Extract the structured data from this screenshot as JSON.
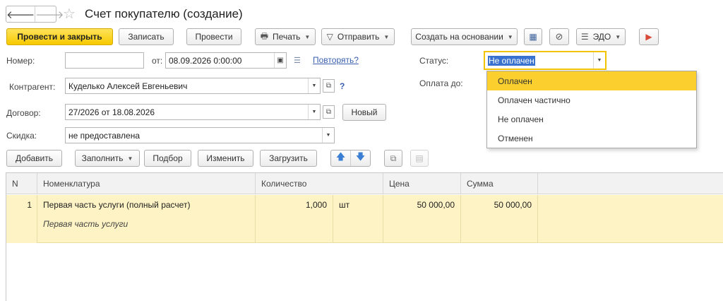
{
  "header": {
    "title": "Счет покупателю (создание)",
    "back_glyph": "🡐",
    "forward_glyph": "🡒"
  },
  "toolbar": {
    "post_close": "Провести и закрыть",
    "save": "Записать",
    "post": "Провести",
    "print": "Печать",
    "send": "Отправить",
    "create_based": "Создать на основании",
    "edo": "ЭДО"
  },
  "form": {
    "number_label": "Номер:",
    "number_value": "",
    "date_label": "от:",
    "date_value": "08.09.2026  0:00:00",
    "repeat_link": "Повторять?",
    "contractor_label": "Контрагент:",
    "contractor_value": "Куделько Алексей Евгеньевич",
    "help": "?",
    "contract_label": "Договор:",
    "contract_value": "27/2026 от 18.08.2026",
    "new_button": "Новый",
    "discount_label": "Скидка:",
    "discount_value": "не предоставлена",
    "status_label": "Статус:",
    "status_value": "Не оплачен",
    "pay_until_label": "Оплата до:"
  },
  "status_dropdown": {
    "options": [
      "Оплачен",
      "Оплачен частично",
      "Не оплачен",
      "Отменен"
    ],
    "highlighted": "Оплачен"
  },
  "table_toolbar": {
    "add": "Добавить",
    "fill": "Заполнить",
    "select": "Подбор",
    "change": "Изменить",
    "load": "Загрузить"
  },
  "table": {
    "columns": [
      "N",
      "Номенклатура",
      "Количество",
      "Цена",
      "Сумма"
    ],
    "rows": [
      {
        "n": "1",
        "item": "Первая часть услуги (полный расчет)",
        "item_desc": "Первая часть услуги",
        "qty": "1,000",
        "unit": "шт",
        "price": "50 000,00",
        "sum": "50 000,00"
      }
    ]
  },
  "colors": {
    "primary": "#f6c900",
    "row_highlight": "#fdf3c4",
    "link": "#3a5fb0"
  }
}
